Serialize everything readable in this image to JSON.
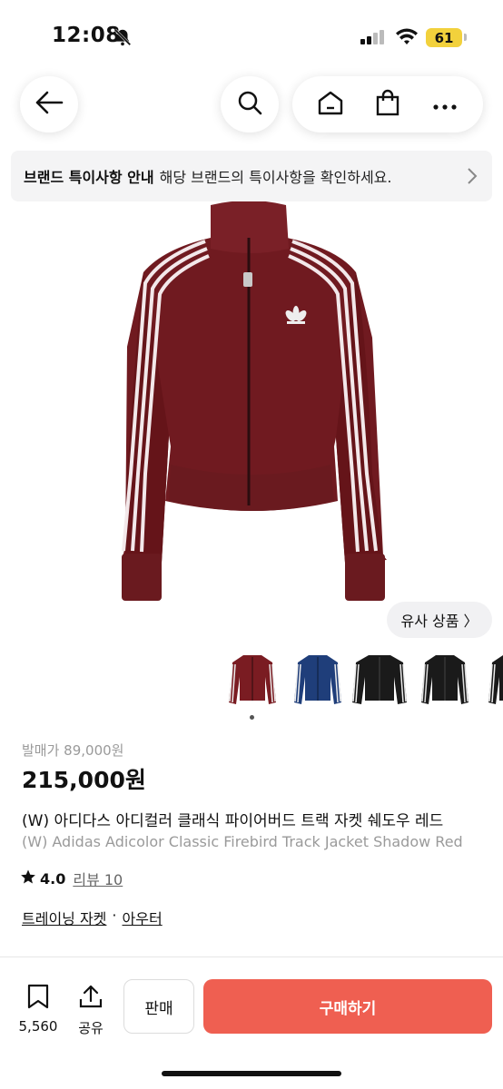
{
  "status_bar": {
    "time": "12:08",
    "battery": "61"
  },
  "brand_notice": {
    "title": "브랜드 특이사항 안내",
    "message": "해당 브랜드의 특이사항을 확인하세요."
  },
  "similar": {
    "label": "유사 상품 〉"
  },
  "product": {
    "release_price": "발매가 89,000원",
    "price": "215,000원",
    "title_ko": "(W) 아디다스 아디컬러 클래식 파이어버드 트랙 자켓 쉐도우 레드",
    "title_en": "(W) Adidas Adicolor Classic  Firebird Track Jacket Shadow Red",
    "rating": "4.0",
    "review": "리뷰 10",
    "category_1": "트레이닝 자켓",
    "separator": "·",
    "category_2": "아우터"
  },
  "thumbnails": [
    {
      "color": "#7a1c22"
    },
    {
      "color": "#1f3e7a"
    },
    {
      "color": "#1a1a1a"
    },
    {
      "color": "#1a1a1a"
    },
    {
      "color": "#1a1a1a"
    }
  ],
  "bottom_bar": {
    "bookmark_count": "5,560",
    "share_label": "공유",
    "sell_label": "판매",
    "buy_label": "구매하기"
  },
  "colors": {
    "accent": "#ef5f51",
    "jacket": "#7a1c22"
  },
  "icons": [
    "bell-off-icon",
    "signal-icon",
    "wifi-icon",
    "back-arrow-icon",
    "search-icon",
    "home-icon",
    "shopping-bag-icon",
    "more-icon",
    "chevron-right-icon",
    "star-icon",
    "bookmark-icon",
    "share-icon"
  ]
}
